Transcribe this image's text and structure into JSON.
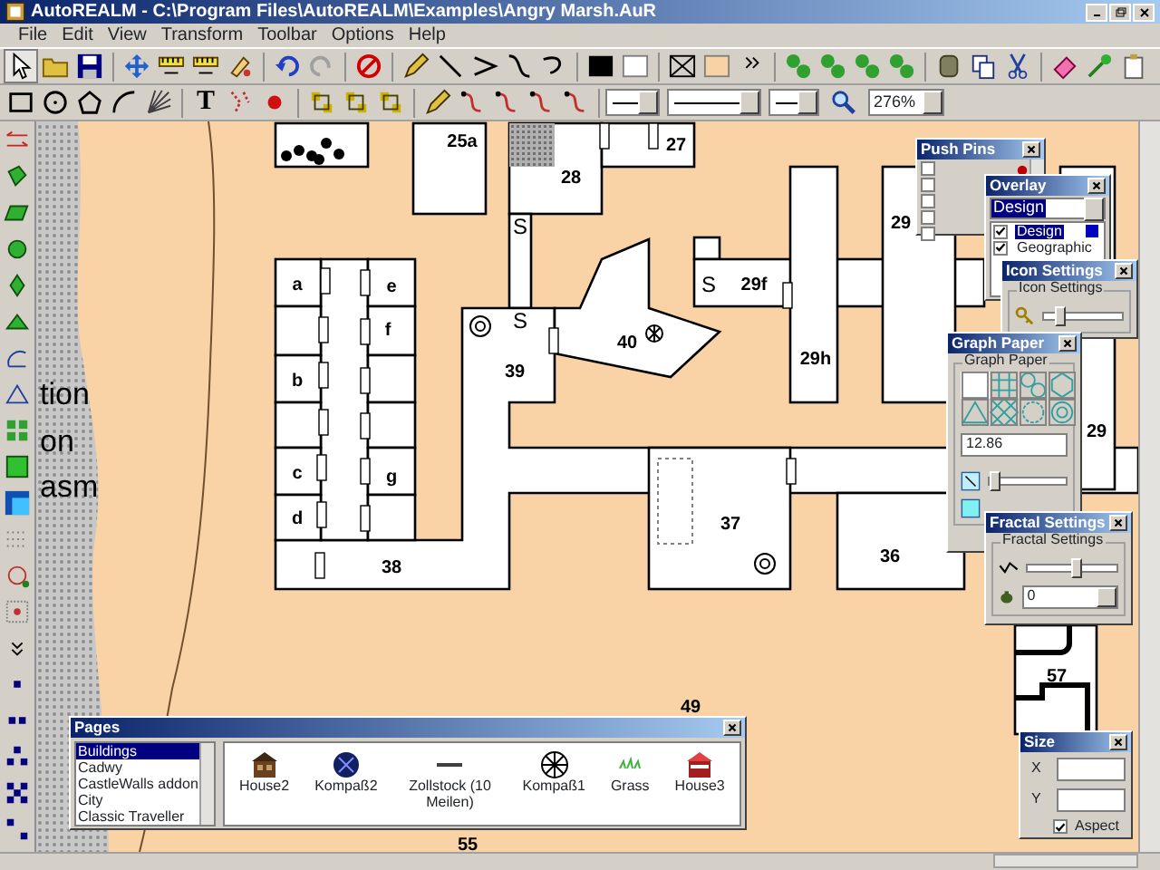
{
  "window": {
    "title": "AutoREALM - C:\\Program Files\\AutoREALM\\Examples\\Angry Marsh.AuR"
  },
  "menu": [
    "File",
    "Edit",
    "View",
    "Transform",
    "Toolbar",
    "Options",
    "Help"
  ],
  "toolbar": {
    "text_tool": "T",
    "zoom": "276%"
  },
  "map": {
    "labels": [
      {
        "text": "25a"
      },
      {
        "text": "27"
      },
      {
        "text": "28"
      },
      {
        "text": "29"
      },
      {
        "text": "S"
      },
      {
        "text": "a"
      },
      {
        "text": "e"
      },
      {
        "text": "S"
      },
      {
        "text": "29f"
      },
      {
        "text": "f"
      },
      {
        "text": "S"
      },
      {
        "text": "40"
      },
      {
        "text": "b"
      },
      {
        "text": "39"
      },
      {
        "text": "29h"
      },
      {
        "text": "29"
      },
      {
        "text": "c"
      },
      {
        "text": "g"
      },
      {
        "text": "d"
      },
      {
        "text": "37"
      },
      {
        "text": "38"
      },
      {
        "text": "36"
      },
      {
        "text": "57"
      },
      {
        "text": "49"
      },
      {
        "text": "55"
      }
    ],
    "side_labels": [
      "tion",
      "on",
      "asm"
    ]
  },
  "push_pins": {
    "title": "Push Pins",
    "pins": [
      {
        "checked": false
      },
      {
        "checked": false
      },
      {
        "checked": false
      },
      {
        "checked": false
      },
      {
        "checked": false
      }
    ]
  },
  "overlay": {
    "title": "Overlay",
    "current": "Design",
    "items": [
      {
        "label": "Design",
        "checked": true,
        "selected": true,
        "color": "#0000c0"
      },
      {
        "label": "Geographic",
        "checked": true,
        "selected": false
      }
    ]
  },
  "icon_settings": {
    "title": "Icon Settings",
    "group": "Icon Settings",
    "level": 0.2
  },
  "graph_paper": {
    "title": "Graph Paper",
    "group": "Graph Paper",
    "value": "12.86",
    "level": 0.08
  },
  "fractal_settings": {
    "title": "Fractal Settings",
    "group": "Fractal Settings",
    "level": 0.55,
    "value": "0"
  },
  "pages": {
    "title": "Pages",
    "categories": [
      {
        "label": "Buildings",
        "selected": true
      },
      {
        "label": "Cadwy",
        "selected": false
      },
      {
        "label": "CastleWalls addon",
        "selected": false
      },
      {
        "label": "City",
        "selected": false
      },
      {
        "label": "Classic Traveller",
        "selected": false
      }
    ],
    "symbols": [
      {
        "label": "House2"
      },
      {
        "label": "Kompaß2"
      },
      {
        "label": "Zollstock (10 Meilen)"
      },
      {
        "label": "Kompaß1"
      },
      {
        "label": "Grass"
      },
      {
        "label": "House3"
      }
    ]
  },
  "size": {
    "title": "Size",
    "x_label": "X",
    "y_label": "Y",
    "aspect": {
      "label": "Aspect",
      "checked": true
    }
  }
}
